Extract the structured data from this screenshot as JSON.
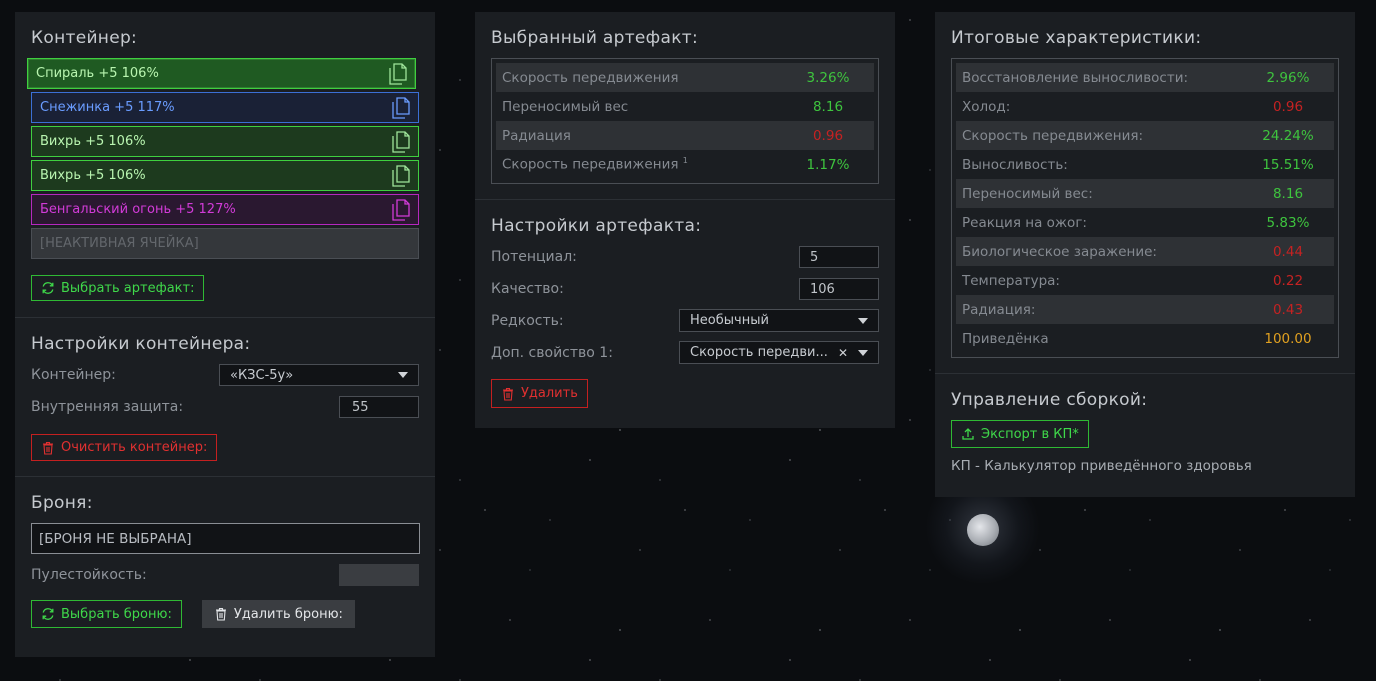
{
  "container_panel": {
    "title": "Контейнер:",
    "slots": [
      {
        "label": "Спираль +5 106%"
      },
      {
        "label": "Снежинка +5 117%"
      },
      {
        "label": "Вихрь +5 106%"
      },
      {
        "label": "Вихрь +5 106%"
      },
      {
        "label": "Бенгальский огонь +5 127%"
      },
      {
        "label": "[НЕАКТИВНАЯ ЯЧЕЙКА]"
      }
    ],
    "select_artifact_button": "Выбрать артефакт:",
    "settings_title": "Настройки контейнера:",
    "container_label": "Контейнер:",
    "container_value": "«КЗС-5у»",
    "inner_protection_label": "Внутренняя защита:",
    "inner_protection_value": "55",
    "clear_button": "Очистить контейнер:",
    "armor_title": "Броня:",
    "armor_value": "[БРОНЯ НЕ ВЫБРАНА]",
    "bullet_resist_label": "Пулестойкость:",
    "bullet_resist_value": "",
    "select_armor_button": "Выбрать броню:",
    "delete_armor_button": "Удалить броню:"
  },
  "artifact_panel": {
    "title": "Выбранный артефакт:",
    "stats": [
      {
        "name": "Скорость передвижения",
        "value": "3.26%"
      },
      {
        "name": "Переносимый вес",
        "value": "8.16"
      },
      {
        "name": "Радиация",
        "value": "0.96"
      },
      {
        "name": "Скорость передвижения",
        "sup": "1",
        "value": "1.17%"
      }
    ],
    "settings_title": "Настройки артефакта:",
    "potential_label": "Потенциал:",
    "potential_value": "5",
    "quality_label": "Качество:",
    "quality_value": "106",
    "rarity_label": "Редкость:",
    "rarity_value": "Необычный",
    "extra_prop_label": "Доп. свойство 1:",
    "extra_prop_value": "Скорость передви...",
    "delete_button": "Удалить"
  },
  "summary_panel": {
    "title": "Итоговые характеристики:",
    "stats": [
      {
        "name": "Восстановление выносливости:",
        "value": "2.96%"
      },
      {
        "name": "Холод:",
        "value": "0.96"
      },
      {
        "name": "Скорость передвижения:",
        "value": "24.24%"
      },
      {
        "name": "Выносливость:",
        "value": "15.51%"
      },
      {
        "name": "Переносимый вес:",
        "value": "8.16"
      },
      {
        "name": "Реакция на ожог:",
        "value": "5.83%"
      },
      {
        "name": "Биологическое заражение:",
        "value": "0.44"
      },
      {
        "name": "Температура:",
        "value": "0.22"
      },
      {
        "name": "Радиация:",
        "value": "0.43"
      },
      {
        "name": "Приведёнка",
        "value": "100.00"
      }
    ],
    "build_title": "Управление сборкой:",
    "export_button": "Экспорт в КП*",
    "footnote": "КП - Калькулятор приведённого здоровья"
  },
  "colors": {
    "green": "#3ec43e",
    "red": "#c52222",
    "orange": "#e0a020",
    "blue": "#6a9cff",
    "purple": "#d23bd8",
    "panel": "#1b1e22"
  }
}
